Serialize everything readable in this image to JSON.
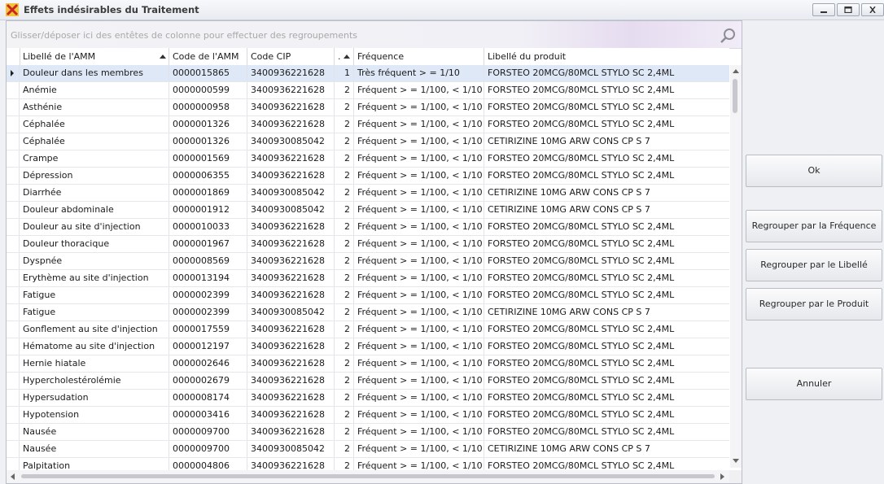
{
  "window": {
    "title": "Effets indésirables du Traitement"
  },
  "group_panel": {
    "hint": "Glisser/déposer ici des entêtes de colonne pour effectuer des regroupements"
  },
  "columns": [
    "Libellé de l'AMM",
    "Code de l'AMM",
    "Code CIP",
    ".",
    "Fréquence",
    "Libellé du produit"
  ],
  "rows": [
    [
      "Douleur dans les membres",
      "0000015865",
      "3400936221628",
      "1",
      "Très fréquent > = 1/10",
      "FORSTEO 20MCG/80MCL STYLO SC 2,4ML"
    ],
    [
      "Anémie",
      "0000000599",
      "3400936221628",
      "2",
      "Fréquent > = 1/100, < 1/10",
      "FORSTEO 20MCG/80MCL STYLO SC 2,4ML"
    ],
    [
      "Asthénie",
      "0000000958",
      "3400936221628",
      "2",
      "Fréquent > = 1/100, < 1/10",
      "FORSTEO 20MCG/80MCL STYLO SC 2,4ML"
    ],
    [
      "Céphalée",
      "0000001326",
      "3400936221628",
      "2",
      "Fréquent > = 1/100, < 1/10",
      "FORSTEO 20MCG/80MCL STYLO SC 2,4ML"
    ],
    [
      "Céphalée",
      "0000001326",
      "3400930085042",
      "2",
      "Fréquent > = 1/100, < 1/10",
      "CETIRIZINE 10MG ARW CONS CP S 7"
    ],
    [
      "Crampe",
      "0000001569",
      "3400936221628",
      "2",
      "Fréquent > = 1/100, < 1/10",
      "FORSTEO 20MCG/80MCL STYLO SC 2,4ML"
    ],
    [
      "Dépression",
      "0000006355",
      "3400936221628",
      "2",
      "Fréquent > = 1/100, < 1/10",
      "FORSTEO 20MCG/80MCL STYLO SC 2,4ML"
    ],
    [
      "Diarrhée",
      "0000001869",
      "3400930085042",
      "2",
      "Fréquent > = 1/100, < 1/10",
      "CETIRIZINE 10MG ARW CONS CP S 7"
    ],
    [
      "Douleur abdominale",
      "0000001912",
      "3400930085042",
      "2",
      "Fréquent > = 1/100, < 1/10",
      "CETIRIZINE 10MG ARW CONS CP S 7"
    ],
    [
      "Douleur au site d'injection",
      "0000010033",
      "3400936221628",
      "2",
      "Fréquent > = 1/100, < 1/10",
      "FORSTEO 20MCG/80MCL STYLO SC 2,4ML"
    ],
    [
      "Douleur thoracique",
      "0000001967",
      "3400936221628",
      "2",
      "Fréquent > = 1/100, < 1/10",
      "FORSTEO 20MCG/80MCL STYLO SC 2,4ML"
    ],
    [
      "Dyspnée",
      "0000008569",
      "3400936221628",
      "2",
      "Fréquent > = 1/100, < 1/10",
      "FORSTEO 20MCG/80MCL STYLO SC 2,4ML"
    ],
    [
      "Erythème au site d'injection",
      "0000013194",
      "3400936221628",
      "2",
      "Fréquent > = 1/100, < 1/10",
      "FORSTEO 20MCG/80MCL STYLO SC 2,4ML"
    ],
    [
      "Fatigue",
      "0000002399",
      "3400936221628",
      "2",
      "Fréquent > = 1/100, < 1/10",
      "FORSTEO 20MCG/80MCL STYLO SC 2,4ML"
    ],
    [
      "Fatigue",
      "0000002399",
      "3400930085042",
      "2",
      "Fréquent > = 1/100, < 1/10",
      "CETIRIZINE 10MG ARW CONS CP S 7"
    ],
    [
      "Gonflement au site d'injection",
      "0000017559",
      "3400936221628",
      "2",
      "Fréquent > = 1/100, < 1/10",
      "FORSTEO 20MCG/80MCL STYLO SC 2,4ML"
    ],
    [
      "Hématome au site d'injection",
      "0000012197",
      "3400936221628",
      "2",
      "Fréquent > = 1/100, < 1/10",
      "FORSTEO 20MCG/80MCL STYLO SC 2,4ML"
    ],
    [
      "Hernie hiatale",
      "0000002646",
      "3400936221628",
      "2",
      "Fréquent > = 1/100, < 1/10",
      "FORSTEO 20MCG/80MCL STYLO SC 2,4ML"
    ],
    [
      "Hypercholestérolémie",
      "0000002679",
      "3400936221628",
      "2",
      "Fréquent > = 1/100, < 1/10",
      "FORSTEO 20MCG/80MCL STYLO SC 2,4ML"
    ],
    [
      "Hypersudation",
      "0000008174",
      "3400936221628",
      "2",
      "Fréquent > = 1/100, < 1/10",
      "FORSTEO 20MCG/80MCL STYLO SC 2,4ML"
    ],
    [
      "Hypotension",
      "0000003416",
      "3400936221628",
      "2",
      "Fréquent > = 1/100, < 1/10",
      "FORSTEO 20MCG/80MCL STYLO SC 2,4ML"
    ],
    [
      "Nausée",
      "0000009700",
      "3400936221628",
      "2",
      "Fréquent > = 1/100, < 1/10",
      "FORSTEO 20MCG/80MCL STYLO SC 2,4ML"
    ],
    [
      "Nausée",
      "0000009700",
      "3400930085042",
      "2",
      "Fréquent > = 1/100, < 1/10",
      "CETIRIZINE 10MG ARW CONS CP S 7"
    ],
    [
      "Palpitation",
      "0000004806",
      "3400936221628",
      "2",
      "Fréquent > = 1/100, < 1/10",
      "FORSTEO 20MCG/80MCL STYLO SC 2,4ML"
    ]
  ],
  "buttons": {
    "ok": "Ok",
    "group_frequency": "Regrouper par la Fréquence",
    "group_label": "Regrouper par le Libellé",
    "group_product": "Regrouper par le Produit",
    "cancel": "Annuler"
  },
  "icons": {
    "app": "app-x-icon",
    "minimize": "minimize-icon",
    "maximize": "maximize-icon",
    "close": "close-icon",
    "search": "search-icon"
  }
}
